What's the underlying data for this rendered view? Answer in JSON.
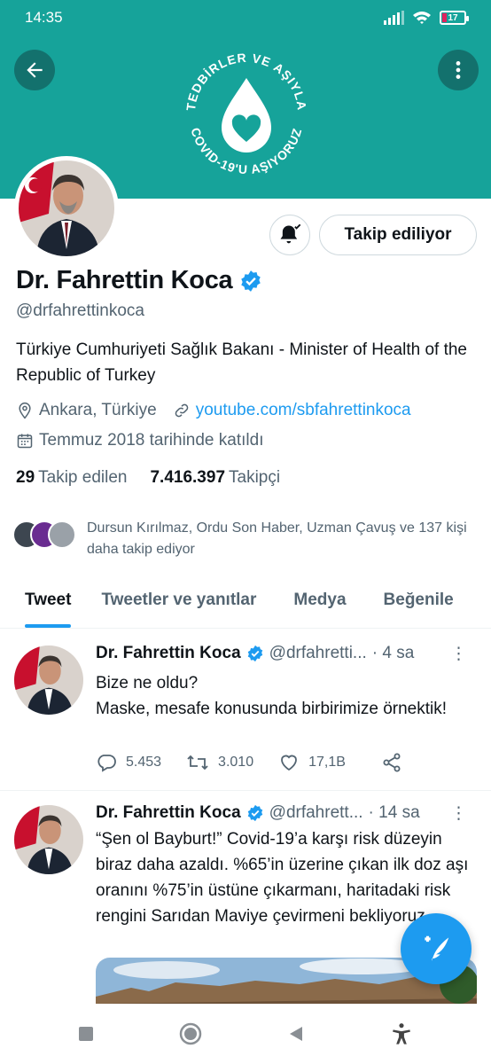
{
  "status_bar": {
    "time": "14:35",
    "battery": "17"
  },
  "banner": {
    "campaign_top": "TEDBİRLER VE AŞIYLA",
    "campaign_bottom": "COVID-19'U AŞIYORUZ",
    "color": "#16a39a"
  },
  "profile": {
    "follow_button": "Takip ediliyor",
    "name": "Dr. Fahrettin Koca",
    "handle": "@drfahrettinkoca",
    "bio": "Türkiye Cumhuriyeti Sağlık Bakanı - Minister of Health of the Republic of Turkey",
    "location": "Ankara, Türkiye",
    "website": "youtube.com/sbfahrettinkoca",
    "joined": "Temmuz 2018 tarihinde katıldı",
    "following_count": "29",
    "following_label": "Takip edilen",
    "followers_count": "7.416.397",
    "followers_label": "Takipçi",
    "known_followers": "Dursun Kırılmaz, Ordu Son Haber, Uzman Çavuş ve 137 kişi daha takip ediyor"
  },
  "tabs": [
    "Tweet",
    "Tweetler ve yanıtlar",
    "Medya",
    "Beğenile"
  ],
  "tweets": [
    {
      "name": "Dr. Fahrettin Koca",
      "handle": "@drfahretti...",
      "time": "· 4 sa",
      "text_line1": "Bize ne oldu?",
      "text_line2": "Maske, mesafe konusunda birbirimize örnektik!",
      "replies": "5.453",
      "retweets": "3.010",
      "likes": "17,1B"
    },
    {
      "name": "Dr. Fahrettin Koca",
      "handle": "@drfahrett...",
      "time": "· 14 sa",
      "text": "“Şen ol Bayburt!” Covid-19’a karşı risk düzeyin biraz daha azaldı. %65’in üzerine çıkan ilk doz aşı oranını %75’in üstüne çıkarmanı, haritadaki risk rengini Sarıdan Maviye çevirmeni bekliyoruz."
    }
  ],
  "colors": {
    "accent": "#1d9bf0",
    "verified": "#1d9bf0",
    "text_secondary": "#536471"
  }
}
